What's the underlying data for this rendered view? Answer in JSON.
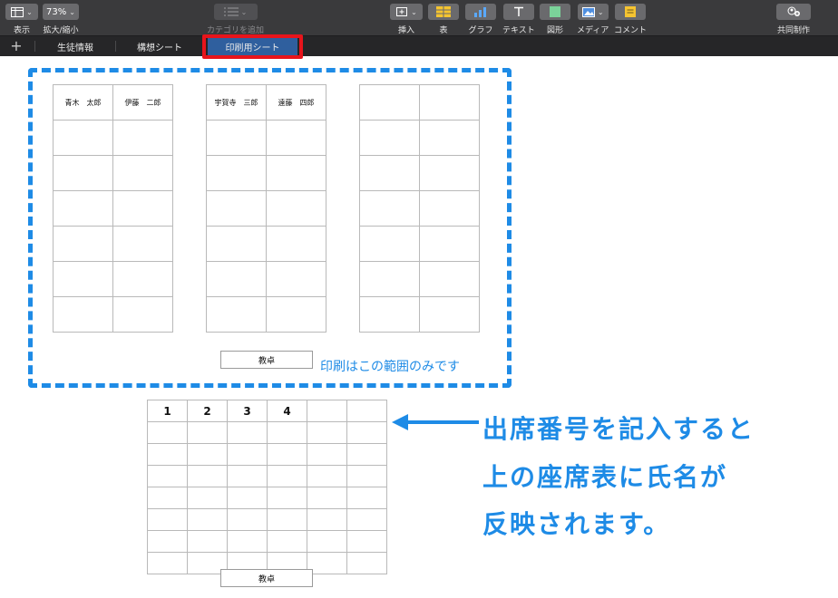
{
  "toolbar": {
    "view": {
      "icon": "sidebar-icon",
      "label": "表示"
    },
    "zoom": {
      "value": "73%",
      "label": "拡大/縮小"
    },
    "category": {
      "icon": "list-icon",
      "label": "カテゴリを追加"
    },
    "insert": {
      "icon": "insert-icon",
      "label": "挿入"
    },
    "table": {
      "icon": "table-icon",
      "label": "表"
    },
    "chart": {
      "icon": "chart-icon",
      "label": "グラフ"
    },
    "text": {
      "icon": "text-icon",
      "label": "テキスト"
    },
    "shape": {
      "icon": "shape-icon",
      "label": "図形"
    },
    "media": {
      "icon": "media-icon",
      "label": "メディア"
    },
    "comment": {
      "icon": "comment-icon",
      "label": "コメント"
    },
    "collaborate": {
      "icon": "collaborate-icon",
      "label": "共同制作"
    }
  },
  "tabs": [
    {
      "label": "生徒情報",
      "active": false
    },
    {
      "label": "構想シート",
      "active": false
    },
    {
      "label": "印刷用シート",
      "active": true
    }
  ],
  "seating": {
    "groups": [
      {
        "names": [
          "青木　太郎",
          "伊藤　二郎"
        ]
      },
      {
        "names": [
          "宇賀寺　三郎",
          "遠藤　四郎"
        ]
      },
      {
        "names": [
          "",
          ""
        ]
      }
    ],
    "desk_label": "教卓",
    "print_note": "印刷はこの範囲のみです"
  },
  "input_table": {
    "header": [
      "1",
      "2",
      "3",
      "4",
      "",
      ""
    ],
    "desk_label": "教卓"
  },
  "callout": {
    "lines": [
      "出席番号を記入すると",
      "上の座席表に氏名が",
      "反映されます。"
    ]
  },
  "colors": {
    "accent": "#1e8be6",
    "highlight": "#e8141b",
    "active_tab": "#2f5f9e"
  }
}
